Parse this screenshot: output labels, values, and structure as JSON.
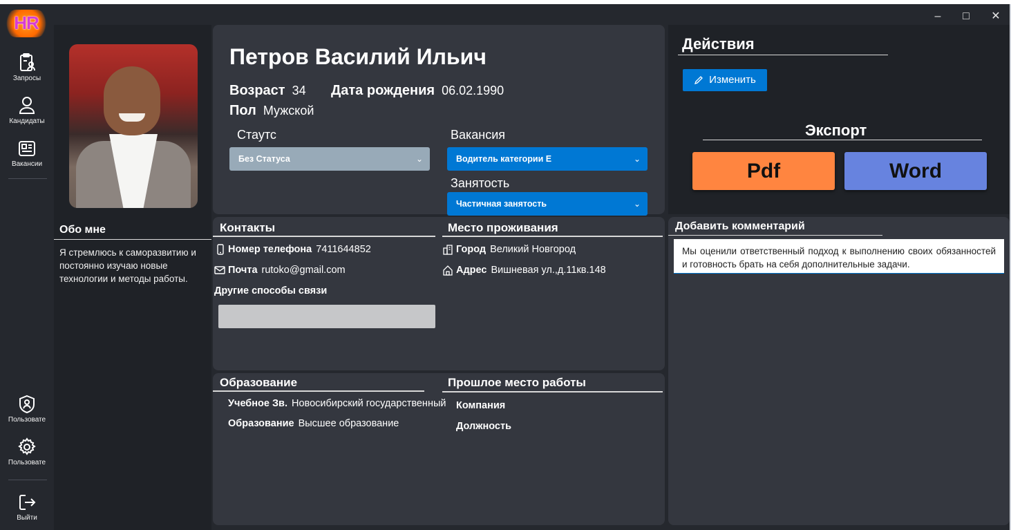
{
  "app": {
    "logo_text": "HR",
    "window_controls": {
      "minimize": "–",
      "maximize": "□",
      "close": "✕"
    }
  },
  "sidebar": {
    "top_items": [
      {
        "label": "Запросы",
        "icon": "clipboard-user-icon"
      },
      {
        "label": "Кандидаты",
        "icon": "person-icon"
      },
      {
        "label": "Вакансии",
        "icon": "newspaper-icon"
      }
    ],
    "bottom_items": [
      {
        "label": "Пользовате",
        "icon": "shield-person-icon"
      },
      {
        "label": "Пользовате",
        "icon": "gear-icon"
      },
      {
        "label": "Выйти",
        "icon": "exit-icon"
      }
    ]
  },
  "about": {
    "title": "Обо мне",
    "text": "Я стремлюсь к саморазвитию и постоянно изучаю новые технологии и методы работы."
  },
  "profile": {
    "name": "Петров Василий Ильич",
    "age_label": "Возраст",
    "age": "34",
    "birth_label": "Дата рождения",
    "birth_date": "06.02.1990",
    "gender_label": "Пол",
    "gender": "Мужской",
    "status_label": "Стаутс",
    "status_value": "Без Статуса",
    "vacancy_label": "Вакансия",
    "vacancy_value": "Водитель категории E",
    "employment_label": "Занятость",
    "employment_value": "Частичная занятость"
  },
  "actions": {
    "title": "Действия",
    "edit_label": "Изменить",
    "export_title": "Экспорт",
    "pdf_label": "Pdf",
    "word_label": "Word"
  },
  "contacts": {
    "title": "Контакты",
    "phone_label": "Номер телефона",
    "phone": "7411644852",
    "email_label": "Почта",
    "email": "rutoko@gmail.com",
    "other_label": "Другие способы связи",
    "other_value": ""
  },
  "residence": {
    "title": "Место проживания",
    "city_label": "Город",
    "city": "Великий Новгород",
    "address_label": "Адрес",
    "address": "Вишневая ул.,д.11кв.148"
  },
  "comment": {
    "title": "Добавить комментарий",
    "text": "Мы оценили ответственный подход к выполнению своих обязанностей и готовность брать на себя дополнительные задачи."
  },
  "education": {
    "title": "Образование",
    "institution_label": "Учебное Зв.",
    "institution": "Новосибирский государственный",
    "level_label": "Образование",
    "level": "Высшее образование"
  },
  "work": {
    "title": "Прошлое место работы",
    "company_label": "Компания",
    "company": "",
    "position_label": "Должность",
    "position": ""
  },
  "colors": {
    "accent": "#0078d4",
    "pdf": "#ff8540",
    "word": "#6783df",
    "status_select": "#98aab8"
  }
}
